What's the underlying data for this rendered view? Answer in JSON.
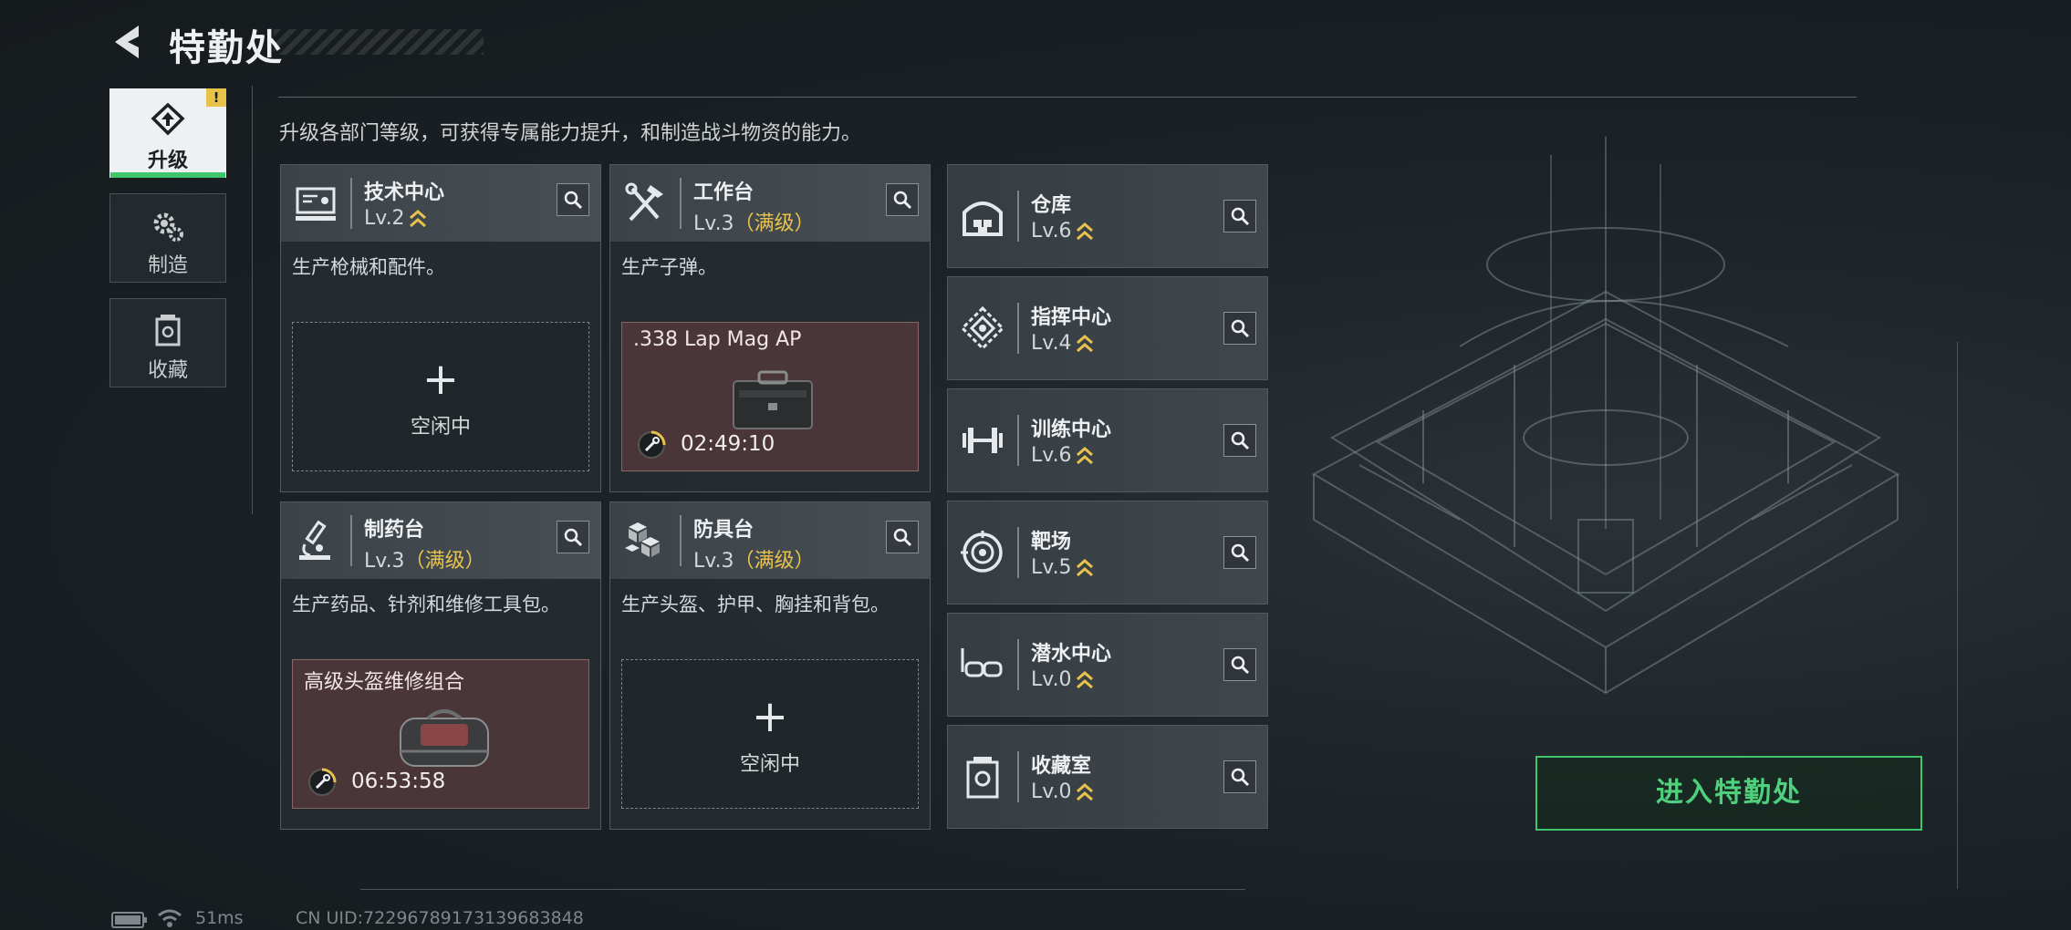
{
  "header": {
    "title": "特勤处"
  },
  "nav": [
    {
      "label": "升级",
      "active": true,
      "badge": "!"
    },
    {
      "label": "制造",
      "active": false
    },
    {
      "label": "收藏",
      "active": false
    }
  ],
  "description": "升级各部门等级，可获得专属能力提升，和制造战斗物资的能力。",
  "cards": [
    {
      "name": "技术中心",
      "level": "Lv.2",
      "max_label": "",
      "desc": "生产枪械和配件。",
      "slot": {
        "state": "idle",
        "idle_label": "空闲中"
      }
    },
    {
      "name": "工作台",
      "level": "Lv.3",
      "max_label": "（满级）",
      "desc": "生产子弹。",
      "slot": {
        "state": "producing",
        "item": ".338 Lap Mag AP",
        "timer": "02:49:10"
      }
    },
    {
      "name": "制药台",
      "level": "Lv.3",
      "max_label": "（满级）",
      "desc": "生产药品、针剂和维修工具包。",
      "slot": {
        "state": "producing",
        "item": "高级头盔维修组合",
        "timer": "06:53:58"
      }
    },
    {
      "name": "防具台",
      "level": "Lv.3",
      "max_label": "（满级）",
      "desc": "生产头盔、护甲、胸挂和背包。",
      "slot": {
        "state": "idle",
        "idle_label": "空闲中"
      }
    }
  ],
  "rows": [
    {
      "name": "仓库",
      "level": "Lv.6",
      "icon": "warehouse-icon"
    },
    {
      "name": "指挥中心",
      "level": "Lv.4",
      "icon": "command-center-icon"
    },
    {
      "name": "训练中心",
      "level": "Lv.6",
      "icon": "dumbbell-icon"
    },
    {
      "name": "靶场",
      "level": "Lv.5",
      "icon": "target-icon"
    },
    {
      "name": "潜水中心",
      "level": "Lv.0",
      "icon": "diving-mask-icon"
    },
    {
      "name": "收藏室",
      "level": "Lv.0",
      "icon": "collection-icon"
    }
  ],
  "enter_button": "进入特勤处",
  "status": {
    "ping": "51ms",
    "uid": "CN UID:72296789173139683848"
  },
  "colors": {
    "accent_green": "#3fc56e",
    "max_gold": "#e8c24c",
    "producing_bg": "#4a3638"
  }
}
